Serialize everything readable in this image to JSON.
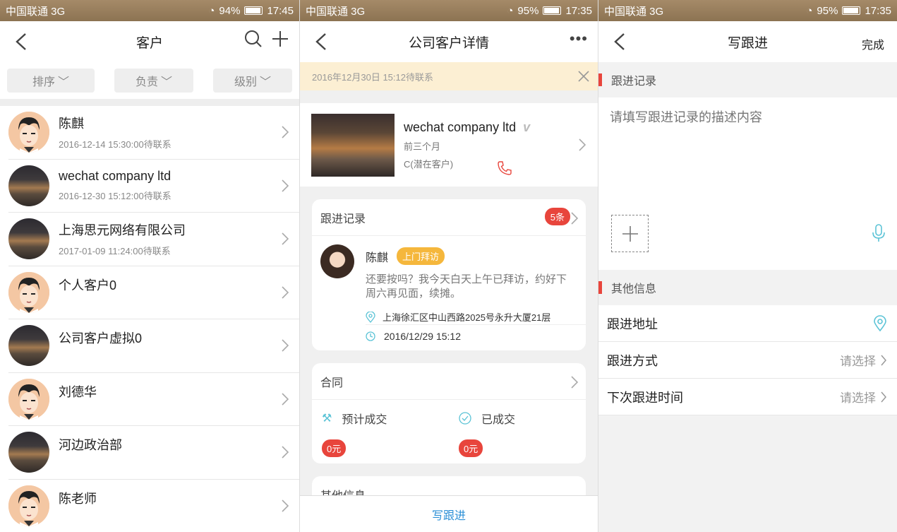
{
  "status": [
    {
      "carrier": "中国联通 3G",
      "battery": "94%",
      "time": "17:45"
    },
    {
      "carrier": "中国联通 3G",
      "battery": "95%",
      "time": "17:35"
    },
    {
      "carrier": "中国联通 3G",
      "battery": "95%",
      "time": "17:35"
    }
  ],
  "list": {
    "title": "客户",
    "filters": [
      "排序",
      "负责",
      "级别"
    ],
    "items": [
      {
        "name": "陈麒",
        "sub": "2016-12-14 15:30:00待联系",
        "avatar": "face"
      },
      {
        "name": "wechat company ltd",
        "sub": "2016-12-30 15:12:00待联系",
        "avatar": "photo"
      },
      {
        "name": "上海思元网络有限公司",
        "sub": "2017-01-09 11:24:00待联系",
        "avatar": "photo"
      },
      {
        "name": "个人客户0",
        "sub": "",
        "avatar": "face"
      },
      {
        "name": "公司客户虚拟0",
        "sub": "",
        "avatar": "photo"
      },
      {
        "name": "刘德华",
        "sub": "",
        "avatar": "face"
      },
      {
        "name": "河边政治部",
        "sub": "",
        "avatar": "photo"
      },
      {
        "name": "陈老师",
        "sub": "",
        "avatar": "face"
      }
    ]
  },
  "detail": {
    "title": "公司客户详情",
    "notice": "2016年12月30日 15:12待联系",
    "company": {
      "name": "wechat company ltd",
      "time": "前三个月",
      "level": "C(潜在客户)"
    },
    "follow": {
      "header": "跟进记录",
      "count": "5条",
      "person": "陈麒",
      "tag": "上门拜访",
      "text": "还要按吗？我今天白天上午已拜访，约好下周六再见面，续摊。",
      "address": "上海徐汇区中山西路2025号永升大厦21层",
      "time": "2016/12/29 15:12"
    },
    "contract": {
      "header": "合同",
      "expected_label": "预计成交",
      "expected_value": "0元",
      "done_label": "已成交",
      "done_value": "0元"
    },
    "other_header": "其他信息",
    "write_button": "写跟进"
  },
  "write": {
    "title": "写跟进",
    "done": "完成",
    "record_header": "跟进记录",
    "placeholder": "请填写跟进记录的描述内容",
    "other_header": "其他信息",
    "rows": [
      {
        "label": "跟进地址",
        "value": ""
      },
      {
        "label": "跟进方式",
        "value": "请选择"
      },
      {
        "label": "下次跟进时间",
        "value": "请选择"
      }
    ]
  },
  "colors": {
    "accent_red": "#e8453c",
    "tag_orange": "#f5b73c",
    "link_blue": "#2b8fd6",
    "icon_teal": "#5bc3d6"
  }
}
